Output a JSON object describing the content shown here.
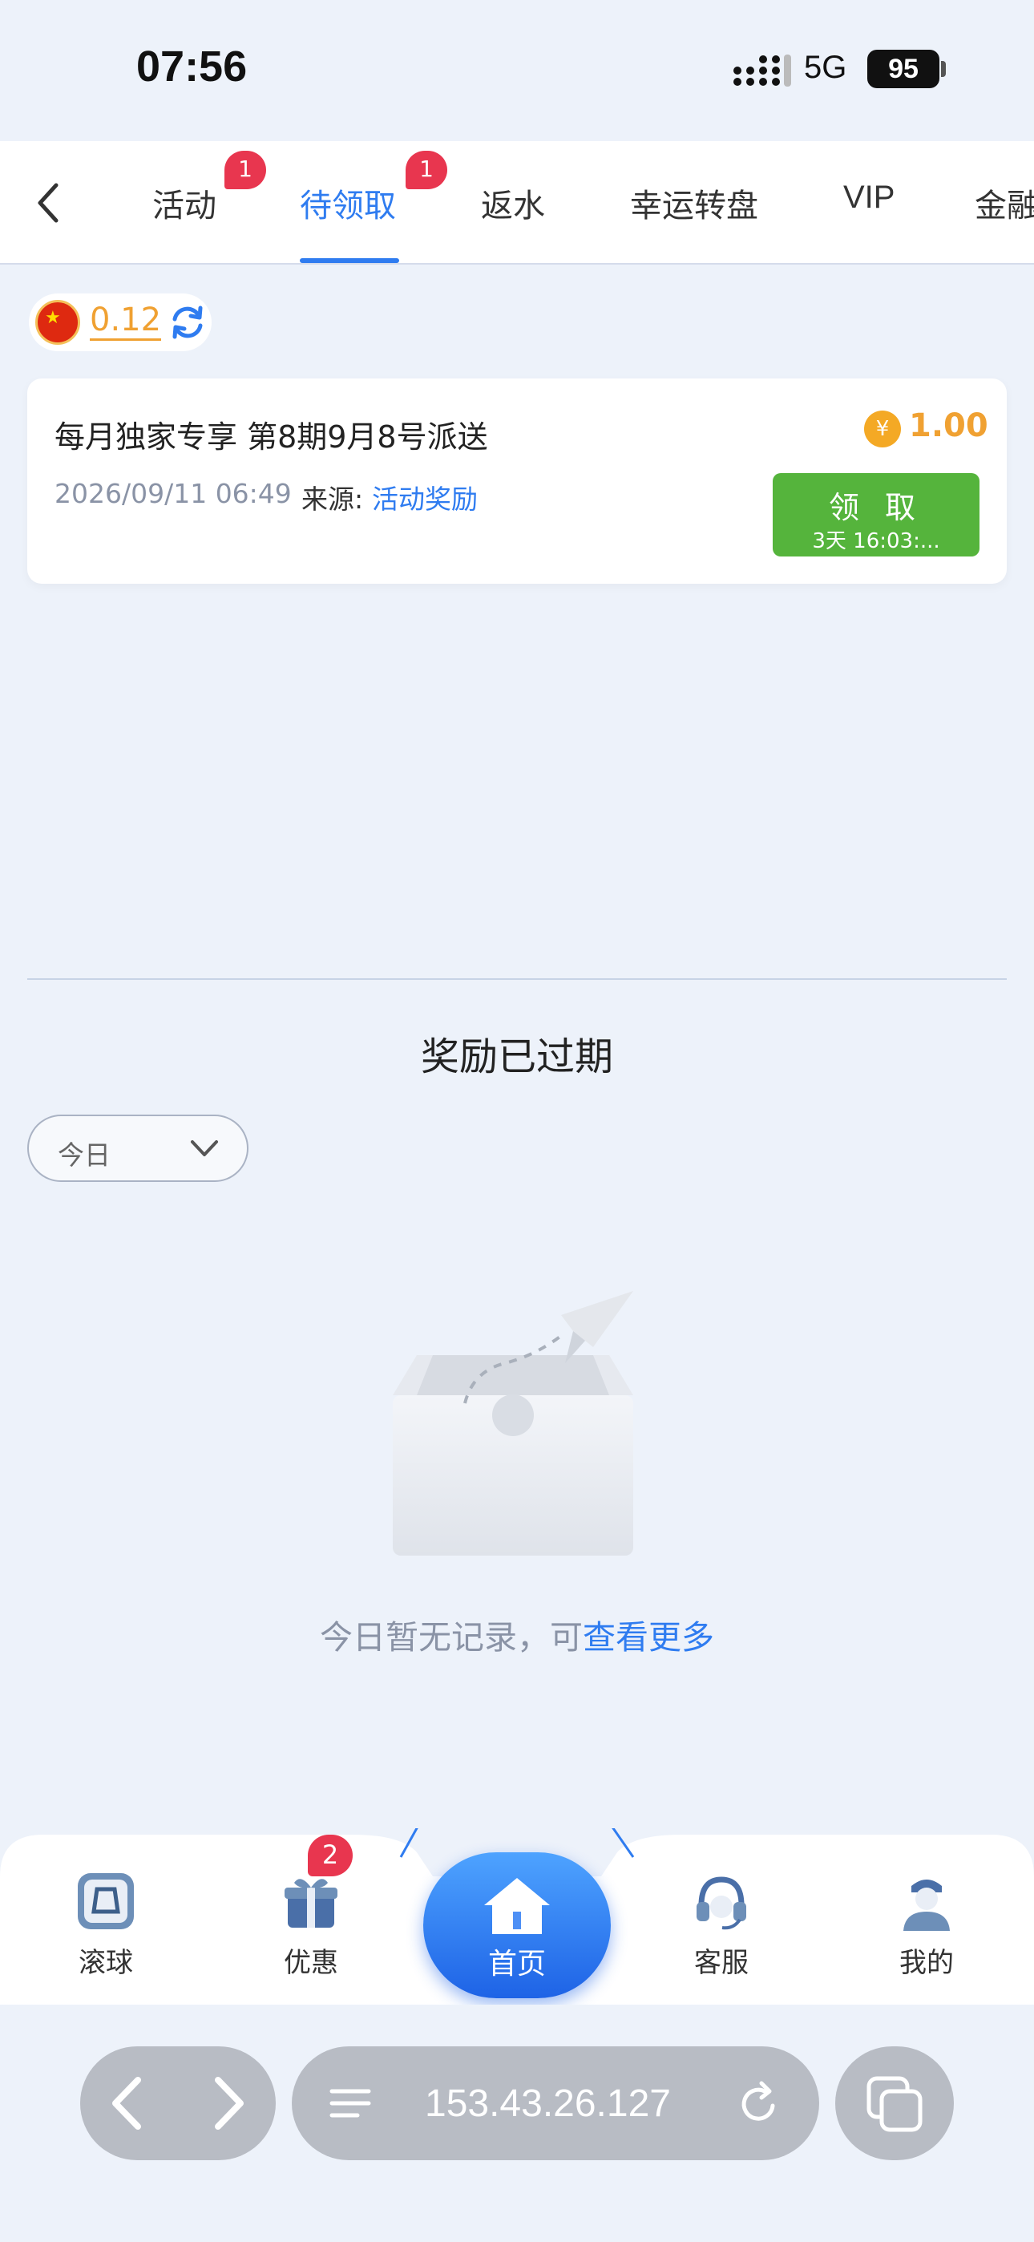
{
  "status_bar": {
    "time": "07:56",
    "network": "5G",
    "battery": "95"
  },
  "tabs": [
    {
      "label": "活动",
      "badge": "1"
    },
    {
      "label": "待领取",
      "badge": "1",
      "active": true
    },
    {
      "label": "返水"
    },
    {
      "label": "幸运转盘"
    },
    {
      "label": "VIP"
    },
    {
      "label": "金融"
    }
  ],
  "balance": {
    "value": "0.12"
  },
  "reward_card": {
    "title": "每月独家专享 第8期9月8号派送",
    "date": "2026/09/11 06:49",
    "source_label": "来源:",
    "source_value": "活动奖励",
    "coin_symbol": "¥",
    "amount": "1.00",
    "claim_label": "领 取",
    "claim_countdown": "3天 16:03:..."
  },
  "expired_section": {
    "title": "奖励已过期",
    "filter_value": "今日",
    "empty_text": "今日暂无记录，可",
    "empty_link": "查看更多"
  },
  "bottom_nav": [
    {
      "label": "滚球"
    },
    {
      "label": "优惠",
      "badge": "2"
    },
    {
      "label": "首页",
      "active": true
    },
    {
      "label": "客服"
    },
    {
      "label": "我的"
    }
  ],
  "browser": {
    "url": "153.43.26.127"
  },
  "colors": {
    "accent": "#2f7cf0",
    "claim_button": "#55b43c",
    "badge": "#e8364f",
    "amount": "#f0a132"
  }
}
